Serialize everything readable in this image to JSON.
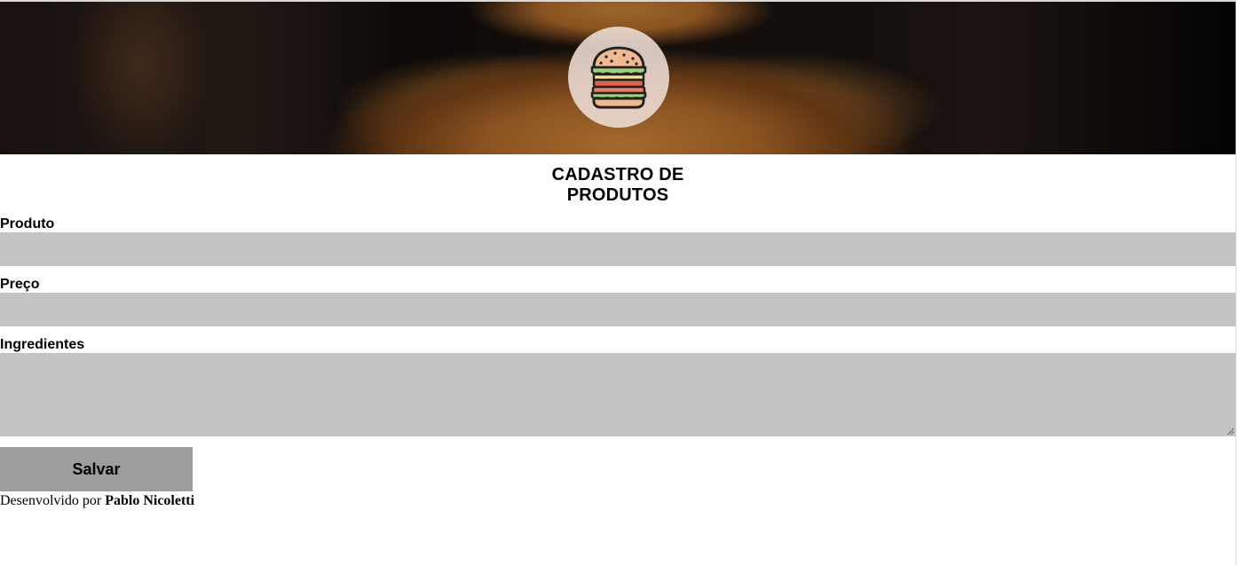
{
  "header": {
    "logo_icon": "burger-icon"
  },
  "title_line1": "CADASTRO DE",
  "title_line2": "PRODUTOS",
  "form": {
    "produto_label": "Produto",
    "produto_value": "",
    "preco_label": "Preço",
    "preco_value": "",
    "ingredientes_label": "Ingredientes",
    "ingredientes_value": "",
    "save_label": "Salvar"
  },
  "footer": {
    "prefix": "Desenvolvido por ",
    "author": "Pablo Nicoletti"
  },
  "colors": {
    "input_bg": "#c3c3c3",
    "button_bg": "#9d9d9d"
  }
}
